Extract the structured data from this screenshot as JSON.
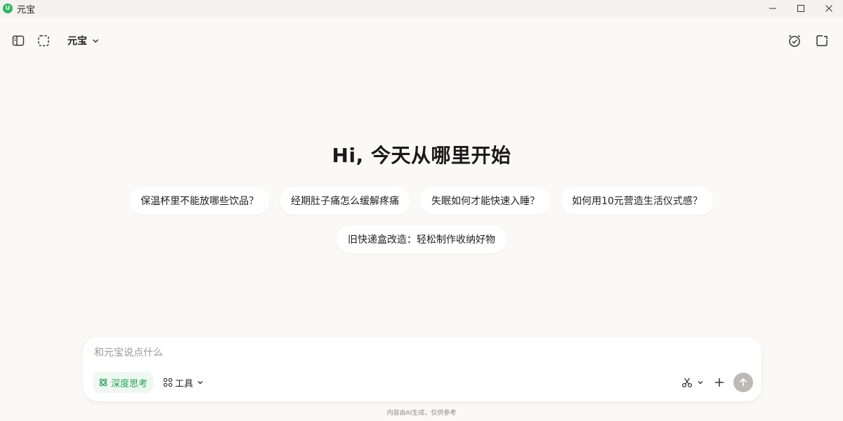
{
  "window": {
    "title": "元宝"
  },
  "toolbar": {
    "model_name": "元宝"
  },
  "hero": {
    "greeting": "Hi, 今天从哪里开始"
  },
  "suggestions": [
    "保温杯里不能放哪些饮品？",
    "经期肚子痛怎么缓解疼痛",
    "失眠如何才能快速入睡？",
    "如何用10元营造生活仪式感？",
    "旧快递盒改造：轻松制作收纳好物"
  ],
  "composer": {
    "placeholder": "和元宝说点什么",
    "deep_think_label": "深度思考",
    "tools_label": "工具"
  },
  "footer": {
    "note": "内容由AI生成，仅供参考"
  },
  "colors": {
    "background": "#fbf9f5",
    "brand_green": "#22a355",
    "send_disabled": "#bdbab5"
  },
  "icons": {
    "sidebar_toggle": "sidebar-toggle-icon",
    "screenshot": "dashed-frame-icon",
    "alarm": "alarm-check-icon",
    "new_window": "new-window-icon",
    "deep_think": "atom-icon",
    "tools": "grid-dots-icon",
    "scissors": "scissors-icon",
    "plus": "plus-icon",
    "send": "arrow-up-icon"
  }
}
